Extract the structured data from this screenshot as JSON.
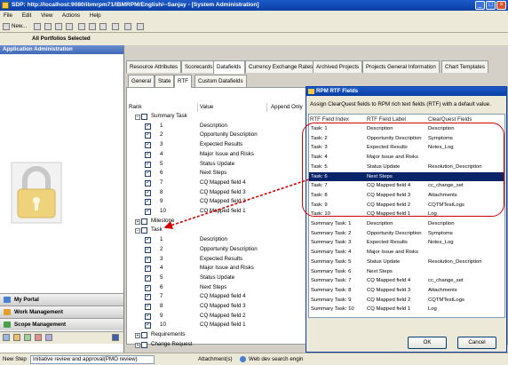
{
  "window": {
    "title": "SDP: http://localhost:9080/ibmrpm71/IBMRPM/English/--Sanjay - [System Administration]"
  },
  "menu": [
    "File",
    "Edit",
    "View",
    "Actions",
    "Help"
  ],
  "toolbar": {
    "new_label": "New..."
  },
  "portfolio_bar": {
    "text": "All Portfolios Selected"
  },
  "left_panel": {
    "header": "Application Administration",
    "nav": [
      "My Portal",
      "Work Management",
      "Scope Management"
    ]
  },
  "tabs_main": [
    "Resource Attributes",
    "Scorecards",
    "Datafields",
    "Currency Exchange Rates",
    "Archived Projects",
    "Projects General Information",
    "Chart Templates"
  ],
  "tabs_sub": [
    "General",
    "State",
    "RTF",
    "Custom Datafields"
  ],
  "grid": {
    "headers": [
      "Rank",
      "Value",
      "Append Only"
    ],
    "groups": [
      {
        "name": "Summary Task",
        "expanded": true,
        "rows": [
          {
            "rank": "1",
            "value": "Description"
          },
          {
            "rank": "2",
            "value": "Opportunity Description"
          },
          {
            "rank": "3",
            "value": "Expected Results"
          },
          {
            "rank": "4",
            "value": "Major Issue and Risks"
          },
          {
            "rank": "5",
            "value": "Status Update"
          },
          {
            "rank": "6",
            "value": "Next Steps"
          },
          {
            "rank": "7",
            "value": "CQ Mapped field 4"
          },
          {
            "rank": "8",
            "value": "CQ Mapped field 3"
          },
          {
            "rank": "9",
            "value": "CQ Mapped field 2"
          },
          {
            "rank": "10",
            "value": "CQ Mapped field 1"
          }
        ]
      },
      {
        "name": "Milestone",
        "expanded": false,
        "rows": []
      },
      {
        "name": "Task",
        "expanded": true,
        "rows": [
          {
            "rank": "1",
            "value": "Description"
          },
          {
            "rank": "2",
            "value": "Opportunity Description"
          },
          {
            "rank": "3",
            "value": "Expected Results"
          },
          {
            "rank": "4",
            "value": "Major Issue and Risks"
          },
          {
            "rank": "5",
            "value": "Status Update"
          },
          {
            "rank": "6",
            "value": "Next Steps"
          },
          {
            "rank": "7",
            "value": "CQ Mapped field 4"
          },
          {
            "rank": "8",
            "value": "CQ Mapped field 3"
          },
          {
            "rank": "9",
            "value": "CQ Mapped field 2"
          },
          {
            "rank": "10",
            "value": "CQ Mapped field 1"
          }
        ]
      },
      {
        "name": "Requirements",
        "expanded": false,
        "rows": []
      },
      {
        "name": "Change Request",
        "expanded": false,
        "rows": []
      }
    ]
  },
  "dialog": {
    "title": "RPM RTF Fields",
    "description": "Assign ClearQuest fields to RPM rich text fields (RTF) with a default value.",
    "headers": [
      "RTF Field Index",
      "RTF Field Label",
      "ClearQuest Fields"
    ],
    "rows": [
      {
        "index": "Task: 1",
        "label": "Description",
        "cq": "Description"
      },
      {
        "index": "Task: 2",
        "label": "Opportunity Description",
        "cq": "Symptoms"
      },
      {
        "index": "Task: 3",
        "label": "Expected Results",
        "cq": "Notes_Log"
      },
      {
        "index": "Task: 4",
        "label": "Major Issue and Risks",
        "cq": ""
      },
      {
        "index": "Task: 5",
        "label": "Status Update",
        "cq": "Resolution_Description"
      },
      {
        "index": "Task: 6",
        "label": "Next Steps",
        "cq": "",
        "selected": true
      },
      {
        "index": "Task: 7",
        "label": "CQ Mapped field 4",
        "cq": "cc_change_set"
      },
      {
        "index": "Task: 8",
        "label": "CQ Mapped field 3",
        "cq": "Attachments"
      },
      {
        "index": "Task: 9",
        "label": "CQ Mapped field 2",
        "cq": "CQTMTestLogs"
      },
      {
        "index": "Task: 10",
        "label": "CQ Mapped field 1",
        "cq": "Log"
      },
      {
        "index": "Summary Task: 1",
        "label": "Description",
        "cq": "Description"
      },
      {
        "index": "Summary Task: 2",
        "label": "Opportunity Description",
        "cq": "Symptoms"
      },
      {
        "index": "Summary Task: 3",
        "label": "Expected Results",
        "cq": "Notes_Log"
      },
      {
        "index": "Summary Task: 4",
        "label": "Major Issue and Risks",
        "cq": ""
      },
      {
        "index": "Summary Task: 5",
        "label": "Status Update",
        "cq": "Resolution_Description"
      },
      {
        "index": "Summary Task: 6",
        "label": "Next Steps",
        "cq": ""
      },
      {
        "index": "Summary Task: 7",
        "label": "CQ Mapped field 4",
        "cq": "cc_change_set"
      },
      {
        "index": "Summary Task: 8",
        "label": "CQ Mapped field 3",
        "cq": "Attachments"
      },
      {
        "index": "Summary Task: 9",
        "label": "CQ Mapped field 2",
        "cq": "CQTMTestLogs"
      },
      {
        "index": "Summary Task: 10",
        "label": "CQ Mapped field 1",
        "cq": "Log"
      }
    ],
    "ok_label": "OK",
    "cancel_label": "Cancel"
  },
  "statusbar": {
    "new_step": "New Step",
    "step_text": "Initiative review and approval(PMO review)",
    "attachments": "Attachment(s)",
    "web_search": "Web dev search engin"
  },
  "colors": {
    "title_blue": "#0a3ea4",
    "selection": "#0a246a",
    "annotation_red": "#d40000"
  }
}
